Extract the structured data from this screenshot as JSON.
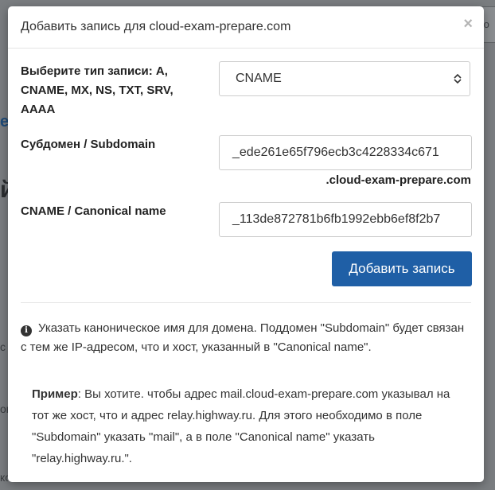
{
  "background": {
    "fragments": [
      "е",
      "й",
      "с",
      "ок",
      "ко"
    ],
    "right_input_text": "сно"
  },
  "modal": {
    "title": "Добавить запись для cloud-exam-prepare.com",
    "close_symbol": "×"
  },
  "form": {
    "type_label": "Выберите тип записи: A, CNAME, MX, NS, TXT, SRV, AAAA",
    "type_selected": "CNAME",
    "subdomain_label": "Субдомен / Subdomain",
    "subdomain_value": "_ede261e65f796ecb3c4228334c671",
    "domain_suffix": ".cloud-exam-prepare.com",
    "cname_label": "CNAME / Canonical name",
    "cname_value": "_113de872781b6fb1992ebb6ef8f2b7",
    "submit_label": "Добавить запись"
  },
  "info": {
    "icon": "info-icon",
    "text": "Указать каноническое имя для домена. Поддомен \"Subdomain\" будет связан с тем же IP-адресом, что и хост, указанный в \"Canonical name\"."
  },
  "example": {
    "label": "Пример",
    "text": ": Вы хотите. чтобы адрес mail.cloud-exam-prepare.com указывал на тот же хост, что и адрес relay.highway.ru. Для этого необходимо в поле \"Subdomain\" указать \"mail\", а в поле \"Canonical name\" указать \"relay.highway.ru.\"."
  },
  "colors": {
    "primary_button": "#1f5fa6",
    "overlay": "#6f7275"
  }
}
